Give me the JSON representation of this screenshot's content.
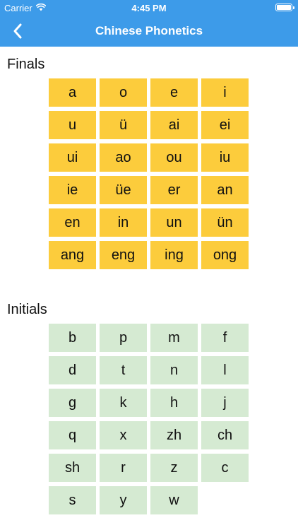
{
  "status_bar": {
    "carrier": "Carrier",
    "time": "4:45 PM",
    "wifi_icon": "wifi-icon",
    "battery_icon": "battery-icon",
    "battery_level": 1.0
  },
  "nav": {
    "title": "Chinese Phonetics",
    "back_icon": "chevron-left-icon"
  },
  "colors": {
    "nav_background": "#3d9be9",
    "finals_tile": "#fccc3c",
    "initials_tile": "#d5ead2"
  },
  "finals": {
    "title": "Finals",
    "items": [
      "a",
      "o",
      "e",
      "i",
      "u",
      "ü",
      "ai",
      "ei",
      "ui",
      "ao",
      "ou",
      "iu",
      "ie",
      "üe",
      "er",
      "an",
      "en",
      "in",
      "un",
      "ün",
      "ang",
      "eng",
      "ing",
      "ong"
    ]
  },
  "initials": {
    "title": "Initials",
    "items": [
      "b",
      "p",
      "m",
      "f",
      "d",
      "t",
      "n",
      "l",
      "g",
      "k",
      "h",
      "j",
      "q",
      "x",
      "zh",
      "ch",
      "sh",
      "r",
      "z",
      "c",
      "s",
      "y",
      "w"
    ]
  }
}
